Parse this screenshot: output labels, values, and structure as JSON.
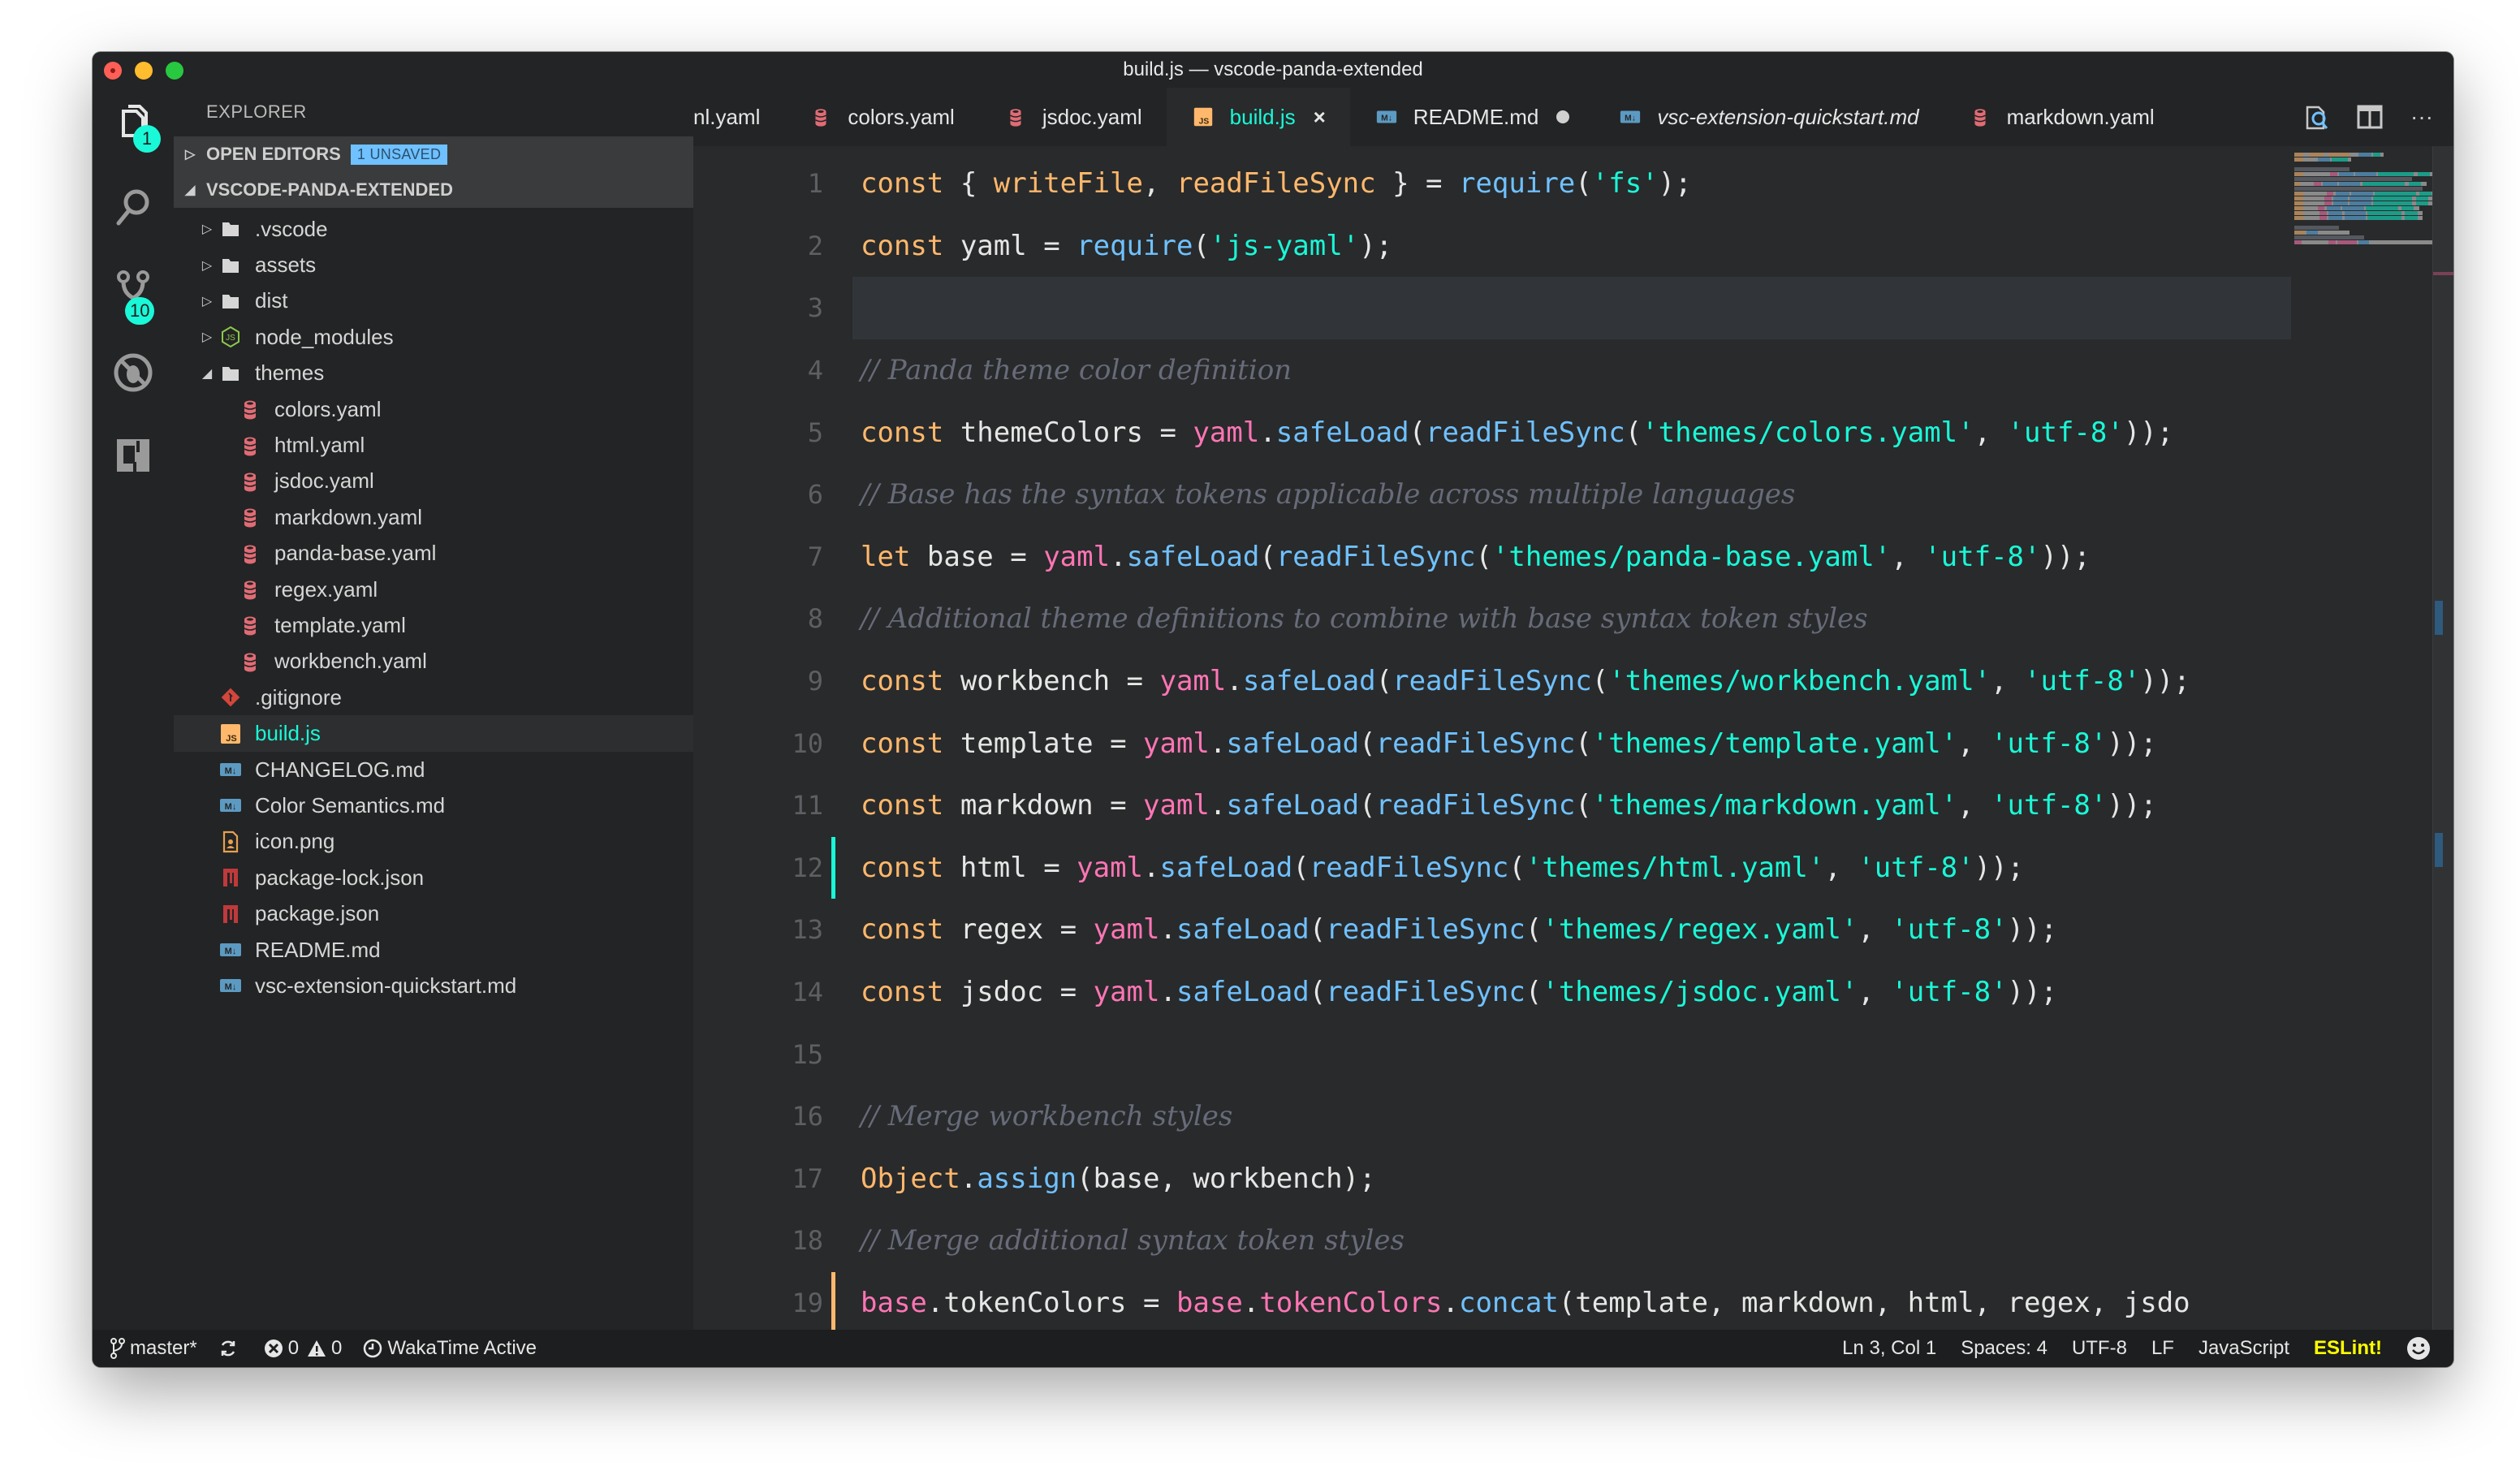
{
  "window": {
    "title": "build.js — vscode-panda-extended"
  },
  "activity_bar": {
    "explorer_badge": "1",
    "scm_badge": "10"
  },
  "sidebar": {
    "title": "EXPLORER",
    "open_editors": {
      "label": "OPEN EDITORS",
      "badge": "1 UNSAVED"
    },
    "project": {
      "label": "VSCODE-PANDA-EXTENDED"
    },
    "tree": [
      {
        "name": ".vscode",
        "type": "folder",
        "depth": 1,
        "expanded": false,
        "icon": "folder-icon"
      },
      {
        "name": "assets",
        "type": "folder",
        "depth": 1,
        "expanded": false,
        "icon": "folder-icon"
      },
      {
        "name": "dist",
        "type": "folder",
        "depth": 1,
        "expanded": false,
        "icon": "folder-icon"
      },
      {
        "name": "node_modules",
        "type": "folder",
        "depth": 1,
        "expanded": false,
        "icon": "nodejs-icon"
      },
      {
        "name": "themes",
        "type": "folder",
        "depth": 1,
        "expanded": true,
        "icon": "folder-icon"
      },
      {
        "name": "colors.yaml",
        "type": "file",
        "depth": 2,
        "icon": "yaml-icon"
      },
      {
        "name": "html.yaml",
        "type": "file",
        "depth": 2,
        "icon": "yaml-icon"
      },
      {
        "name": "jsdoc.yaml",
        "type": "file",
        "depth": 2,
        "icon": "yaml-icon"
      },
      {
        "name": "markdown.yaml",
        "type": "file",
        "depth": 2,
        "icon": "yaml-icon"
      },
      {
        "name": "panda-base.yaml",
        "type": "file",
        "depth": 2,
        "icon": "yaml-icon"
      },
      {
        "name": "regex.yaml",
        "type": "file",
        "depth": 2,
        "icon": "yaml-icon"
      },
      {
        "name": "template.yaml",
        "type": "file",
        "depth": 2,
        "icon": "yaml-icon"
      },
      {
        "name": "workbench.yaml",
        "type": "file",
        "depth": 2,
        "icon": "yaml-icon"
      },
      {
        "name": ".gitignore",
        "type": "file",
        "depth": 1,
        "icon": "git-icon"
      },
      {
        "name": "build.js",
        "type": "file",
        "depth": 1,
        "icon": "js-icon",
        "active": true
      },
      {
        "name": "CHANGELOG.md",
        "type": "file",
        "depth": 1,
        "icon": "markdown-icon"
      },
      {
        "name": "Color Semantics.md",
        "type": "file",
        "depth": 1,
        "icon": "markdown-icon"
      },
      {
        "name": "icon.png",
        "type": "file",
        "depth": 1,
        "icon": "image-icon"
      },
      {
        "name": "package-lock.json",
        "type": "file",
        "depth": 1,
        "icon": "npm-icon"
      },
      {
        "name": "package.json",
        "type": "file",
        "depth": 1,
        "icon": "npm-icon"
      },
      {
        "name": "README.md",
        "type": "file",
        "depth": 1,
        "icon": "markdown-icon"
      },
      {
        "name": "vsc-extension-quickstart.md",
        "type": "file",
        "depth": 1,
        "icon": "markdown-icon"
      }
    ]
  },
  "tabs": [
    {
      "label": "nl.yaml",
      "icon": "",
      "state": "partial"
    },
    {
      "label": "colors.yaml",
      "icon": "yaml-icon"
    },
    {
      "label": "jsdoc.yaml",
      "icon": "yaml-icon"
    },
    {
      "label": "build.js",
      "icon": "js-icon",
      "active": true,
      "close": "×"
    },
    {
      "label": "README.md",
      "icon": "markdown-icon",
      "dirty": true
    },
    {
      "label": "vsc-extension-quickstart.md",
      "icon": "markdown-icon",
      "preview": true
    },
    {
      "label": "markdown.yaml",
      "icon": "yaml-icon"
    }
  ],
  "tab_actions": {
    "more_label": "···"
  },
  "editor": {
    "current_line": 3,
    "gutter_marks": {
      "12": "#19F9D8",
      "19": "#FFB86C"
    },
    "lines": [
      [
        [
          "k",
          "const"
        ],
        [
          "o",
          " { "
        ],
        [
          "k",
          "writeFile"
        ],
        [
          "o",
          ", "
        ],
        [
          "k",
          "readFileSync"
        ],
        [
          "o",
          " } = "
        ],
        [
          "f",
          "require"
        ],
        [
          "o",
          "("
        ],
        [
          "s",
          "'fs'"
        ],
        [
          "o",
          ");"
        ]
      ],
      [
        [
          "k",
          "const"
        ],
        [
          "v",
          " yaml "
        ],
        [
          "o",
          "= "
        ],
        [
          "f",
          "require"
        ],
        [
          "o",
          "("
        ],
        [
          "s",
          "'js-yaml'"
        ],
        [
          "o",
          ");"
        ]
      ],
      [],
      [
        [
          "c",
          "// Panda theme color definition"
        ]
      ],
      [
        [
          "k",
          "const"
        ],
        [
          "v",
          " themeColors "
        ],
        [
          "o",
          "= "
        ],
        [
          "p",
          "yaml"
        ],
        [
          "o",
          "."
        ],
        [
          "f",
          "safeLoad"
        ],
        [
          "o",
          "("
        ],
        [
          "f",
          "readFileSync"
        ],
        [
          "o",
          "("
        ],
        [
          "s",
          "'themes/colors.yaml'"
        ],
        [
          "o",
          ", "
        ],
        [
          "s",
          "'utf-8'"
        ],
        [
          "o",
          "));"
        ]
      ],
      [
        [
          "c",
          "// Base has the syntax tokens applicable across multiple languages"
        ]
      ],
      [
        [
          "k",
          "let"
        ],
        [
          "v",
          " base "
        ],
        [
          "o",
          "= "
        ],
        [
          "p",
          "yaml"
        ],
        [
          "o",
          "."
        ],
        [
          "f",
          "safeLoad"
        ],
        [
          "o",
          "("
        ],
        [
          "f",
          "readFileSync"
        ],
        [
          "o",
          "("
        ],
        [
          "s",
          "'themes/panda-base.yaml'"
        ],
        [
          "o",
          ", "
        ],
        [
          "s",
          "'utf-8'"
        ],
        [
          "o",
          "));"
        ]
      ],
      [
        [
          "c",
          "// Additional theme definitions to combine with base syntax token styles"
        ]
      ],
      [
        [
          "k",
          "const"
        ],
        [
          "v",
          " workbench "
        ],
        [
          "o",
          "= "
        ],
        [
          "p",
          "yaml"
        ],
        [
          "o",
          "."
        ],
        [
          "f",
          "safeLoad"
        ],
        [
          "o",
          "("
        ],
        [
          "f",
          "readFileSync"
        ],
        [
          "o",
          "("
        ],
        [
          "s",
          "'themes/workbench.yaml'"
        ],
        [
          "o",
          ", "
        ],
        [
          "s",
          "'utf-8'"
        ],
        [
          "o",
          "));"
        ]
      ],
      [
        [
          "k",
          "const"
        ],
        [
          "v",
          " template "
        ],
        [
          "o",
          "= "
        ],
        [
          "p",
          "yaml"
        ],
        [
          "o",
          "."
        ],
        [
          "f",
          "safeLoad"
        ],
        [
          "o",
          "("
        ],
        [
          "f",
          "readFileSync"
        ],
        [
          "o",
          "("
        ],
        [
          "s",
          "'themes/template.yaml'"
        ],
        [
          "o",
          ", "
        ],
        [
          "s",
          "'utf-8'"
        ],
        [
          "o",
          "));"
        ]
      ],
      [
        [
          "k",
          "const"
        ],
        [
          "v",
          " markdown "
        ],
        [
          "o",
          "= "
        ],
        [
          "p",
          "yaml"
        ],
        [
          "o",
          "."
        ],
        [
          "f",
          "safeLoad"
        ],
        [
          "o",
          "("
        ],
        [
          "f",
          "readFileSync"
        ],
        [
          "o",
          "("
        ],
        [
          "s",
          "'themes/markdown.yaml'"
        ],
        [
          "o",
          ", "
        ],
        [
          "s",
          "'utf-8'"
        ],
        [
          "o",
          "));"
        ]
      ],
      [
        [
          "k",
          "const"
        ],
        [
          "v",
          " html "
        ],
        [
          "o",
          "= "
        ],
        [
          "p",
          "yaml"
        ],
        [
          "o",
          "."
        ],
        [
          "f",
          "safeLoad"
        ],
        [
          "o",
          "("
        ],
        [
          "f",
          "readFileSync"
        ],
        [
          "o",
          "("
        ],
        [
          "s",
          "'themes/html.yaml'"
        ],
        [
          "o",
          ", "
        ],
        [
          "s",
          "'utf-8'"
        ],
        [
          "o",
          "));"
        ]
      ],
      [
        [
          "k",
          "const"
        ],
        [
          "v",
          " regex "
        ],
        [
          "o",
          "= "
        ],
        [
          "p",
          "yaml"
        ],
        [
          "o",
          "."
        ],
        [
          "f",
          "safeLoad"
        ],
        [
          "o",
          "("
        ],
        [
          "f",
          "readFileSync"
        ],
        [
          "o",
          "("
        ],
        [
          "s",
          "'themes/regex.yaml'"
        ],
        [
          "o",
          ", "
        ],
        [
          "s",
          "'utf-8'"
        ],
        [
          "o",
          "));"
        ]
      ],
      [
        [
          "k",
          "const"
        ],
        [
          "v",
          " jsdoc "
        ],
        [
          "o",
          "= "
        ],
        [
          "p",
          "yaml"
        ],
        [
          "o",
          "."
        ],
        [
          "f",
          "safeLoad"
        ],
        [
          "o",
          "("
        ],
        [
          "f",
          "readFileSync"
        ],
        [
          "o",
          "("
        ],
        [
          "s",
          "'themes/jsdoc.yaml'"
        ],
        [
          "o",
          ", "
        ],
        [
          "s",
          "'utf-8'"
        ],
        [
          "o",
          "));"
        ]
      ],
      [],
      [
        [
          "c",
          "// Merge workbench styles"
        ]
      ],
      [
        [
          "k",
          "Object"
        ],
        [
          "o",
          "."
        ],
        [
          "f",
          "assign"
        ],
        [
          "o",
          "(base, workbench);"
        ]
      ],
      [
        [
          "c",
          "// Merge additional syntax token styles"
        ]
      ],
      [
        [
          "p",
          "base"
        ],
        [
          "o",
          ".tokenColors = "
        ],
        [
          "p",
          "base"
        ],
        [
          "o",
          "."
        ],
        [
          "p",
          "tokenColors"
        ],
        [
          "o",
          "."
        ],
        [
          "f",
          "concat"
        ],
        [
          "o",
          "(template, markdown, html, regex, jsdo"
        ]
      ]
    ]
  },
  "status_bar": {
    "branch": "master*",
    "errors": "0",
    "warnings": "0",
    "wakatime": "WakaTime Active",
    "cursor": "Ln 3, Col 1",
    "indent": "Spaces: 4",
    "encoding": "UTF-8",
    "eol": "LF",
    "language": "JavaScript",
    "eslint": "ESLint!"
  },
  "colors": {
    "accent": "#19F9D8",
    "keyword": "#FFB86C",
    "pink": "#FF75B5",
    "function": "#6FC1FF",
    "string": "#19F9D8",
    "comment": "#676B79",
    "eslint": "#FFFF00"
  }
}
